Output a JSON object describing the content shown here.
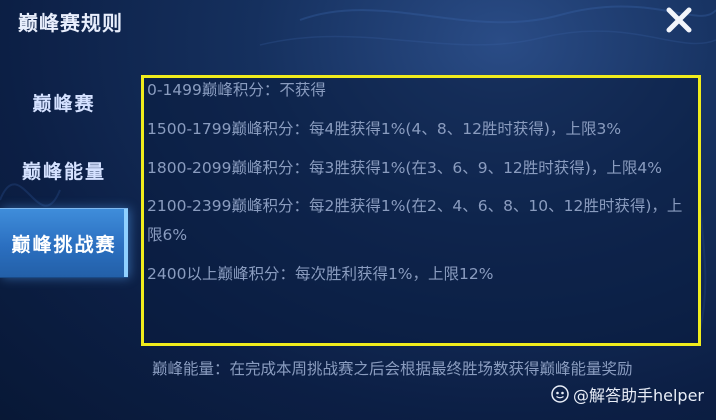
{
  "window": {
    "title": "巅峰赛规则"
  },
  "close_icon": "close-icon",
  "sidebar": {
    "tabs": [
      {
        "label": "巅峰赛"
      },
      {
        "label": "巅峰能量"
      },
      {
        "label": "巅峰挑战赛",
        "active": true
      }
    ]
  },
  "rules": [
    "0-1499巅峰积分：不获得",
    "1500-1799巅峰积分：每4胜获得1%(4、8、12胜时获得)，上限3%",
    "1800-2099巅峰积分：每3胜获得1%(在3、6、9、12胜时获得)，上限4%",
    "2100-2399巅峰积分：每2胜获得1%(在2、4、6、8、10、12胜时获得)，上限6%",
    "2400以上巅峰积分：每次胜利获得1%，上限12%"
  ],
  "footer": {
    "text": "巅峰能量：在完成本周挑战赛之后会根据最终胜场数获得巅峰能量奖励"
  },
  "watermark": {
    "text": "@解答助手helper"
  },
  "colors": {
    "highlight_border": "#f0ec1c",
    "active_tab": "#3f8dda",
    "text_muted": "#8a9cbf",
    "text_light": "#e8eefc"
  }
}
